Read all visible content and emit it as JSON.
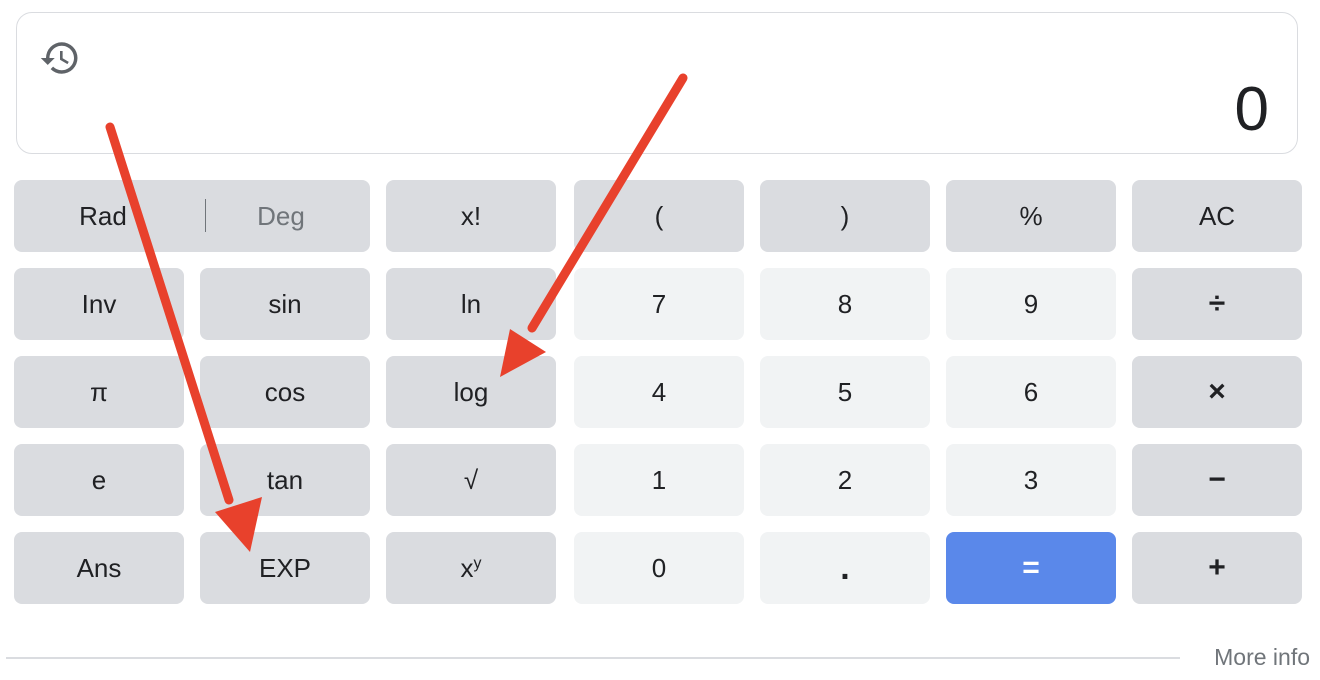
{
  "display": {
    "value": "0",
    "history_icon": "history-icon"
  },
  "keys": {
    "rad": "Rad",
    "deg": "Deg",
    "factorial": "x!",
    "open_paren": "(",
    "close_paren": ")",
    "percent": "%",
    "clear": "AC",
    "inv": "Inv",
    "sin": "sin",
    "ln": "ln",
    "seven": "7",
    "eight": "8",
    "nine": "9",
    "divide": "÷",
    "pi": "π",
    "cos": "cos",
    "log": "log",
    "four": "4",
    "five": "5",
    "six": "6",
    "multiply": "×",
    "e": "e",
    "tan": "tan",
    "sqrt": "√",
    "one": "1",
    "two": "2",
    "three": "3",
    "minus": "−",
    "ans": "Ans",
    "exp": "EXP",
    "power_base": "x",
    "power_exp": "y",
    "zero": "0",
    "dot": ".",
    "equals": "=",
    "plus": "+"
  },
  "footer": {
    "more_info": "More info"
  },
  "colors": {
    "function_key": "#dadce0",
    "number_key": "#f1f3f4",
    "equals_key": "#5a88ea",
    "annotation_arrow": "#e8412c"
  }
}
